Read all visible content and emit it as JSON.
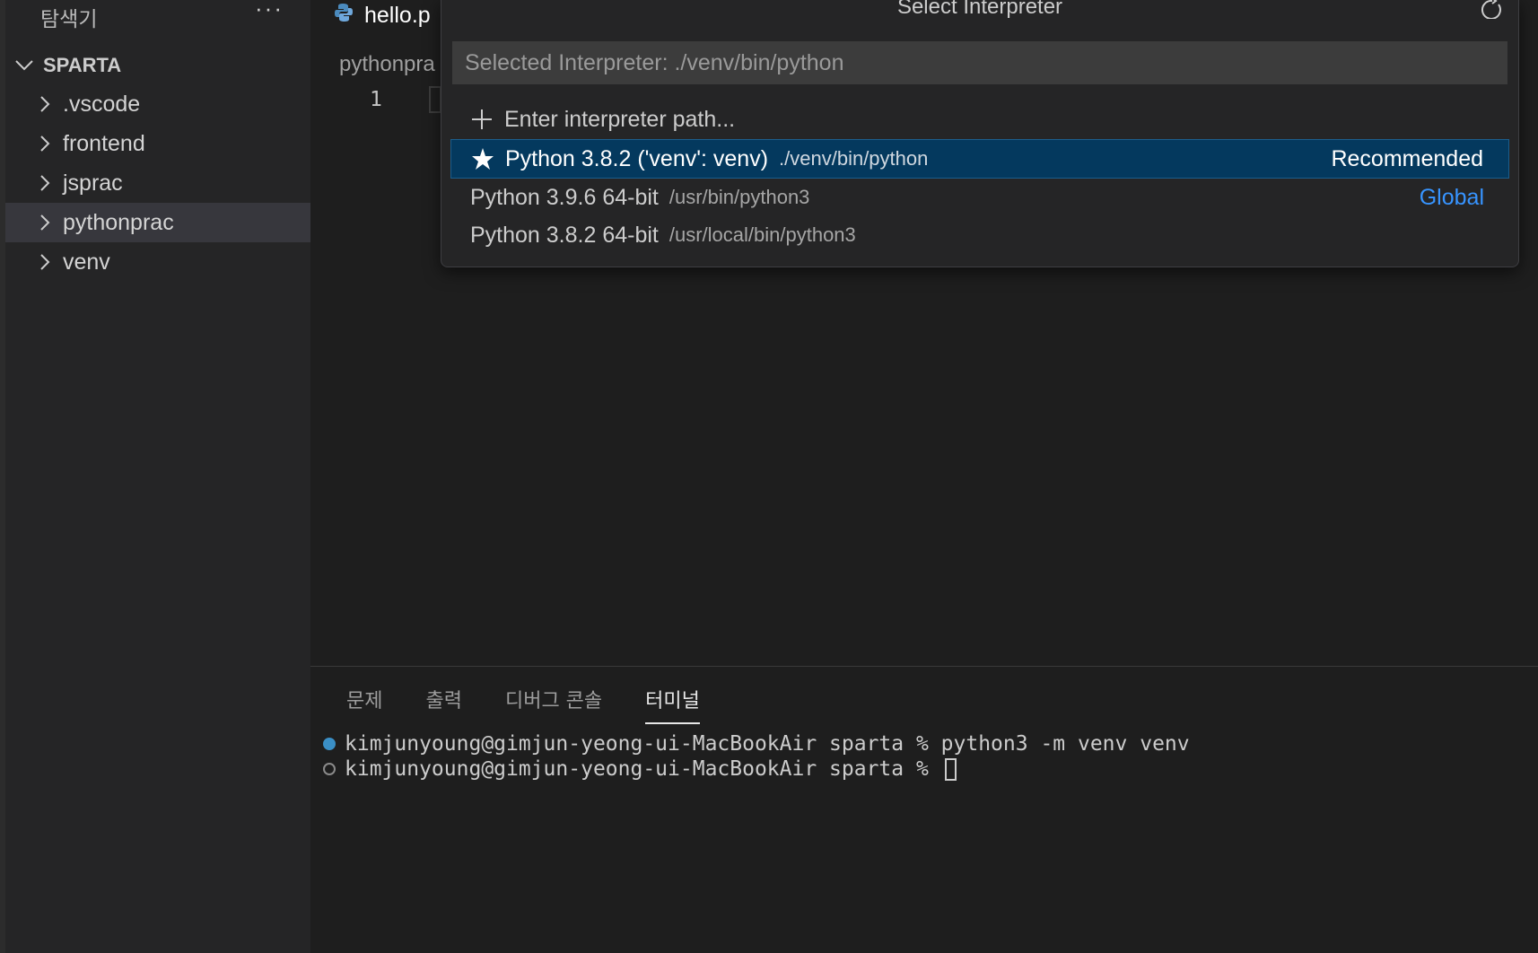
{
  "sidebar": {
    "header": "탐색기",
    "more_label": "···",
    "section_title": "SPARTA",
    "items": [
      {
        "label": ".vscode"
      },
      {
        "label": "frontend"
      },
      {
        "label": "jsprac"
      },
      {
        "label": "pythonprac",
        "selected": true
      },
      {
        "label": "venv"
      }
    ]
  },
  "editor": {
    "tab_label": "hello.p",
    "breadcrumb": "pythonpra",
    "line_number": "1"
  },
  "quickpick": {
    "title": "Select Interpreter",
    "input_placeholder": "Selected Interpreter: ./venv/bin/python",
    "items": [
      {
        "icon": "plus-icon",
        "label": "Enter interpreter path...",
        "description": "",
        "detail": ""
      },
      {
        "icon": "star-icon",
        "label": "Python 3.8.2 ('venv': venv)",
        "description": "./venv/bin/python",
        "detail": "Recommended",
        "selected": true
      },
      {
        "icon": "",
        "label": "Python 3.9.6 64-bit",
        "description": "/usr/bin/python3",
        "detail": "Global"
      },
      {
        "icon": "",
        "label": "Python 3.8.2 64-bit",
        "description": "/usr/local/bin/python3",
        "detail": ""
      }
    ]
  },
  "panel": {
    "tabs": [
      "문제",
      "출력",
      "디버그 콘솔",
      "터미널"
    ],
    "active_tab": "터미널",
    "terminal_lines": [
      "kimjunyoung@gimjun-yeong-ui-MacBookAir sparta % python3 -m venv venv",
      "kimjunyoung@gimjun-yeong-ui-MacBookAir sparta %"
    ]
  },
  "colors": {
    "selection": "#04395e",
    "accent_link": "#3794ff",
    "terminal_dot": "#3a8fc6"
  }
}
